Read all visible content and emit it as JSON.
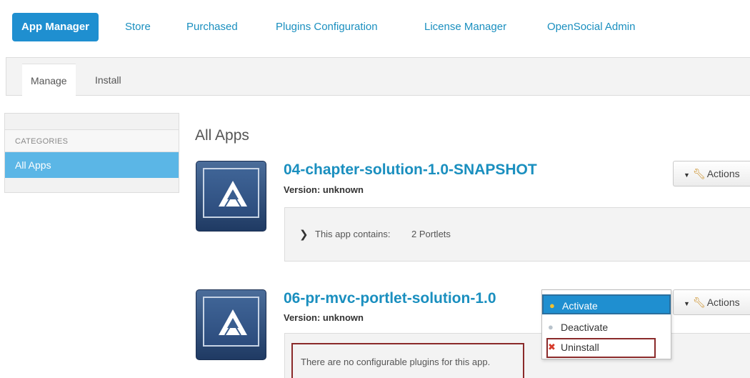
{
  "topnav": {
    "tabs": [
      {
        "label": "App Manager",
        "active": true
      },
      {
        "label": "Store"
      },
      {
        "label": "Purchased"
      },
      {
        "label": "Plugins Configuration"
      },
      {
        "label": "License Manager"
      },
      {
        "label": "OpenSocial Admin"
      }
    ]
  },
  "subnav": {
    "tabs": [
      {
        "label": "Manage",
        "active": true
      },
      {
        "label": "Install"
      }
    ]
  },
  "sidebar": {
    "heading": "CATEGORIES",
    "items": [
      {
        "label": "All Apps",
        "selected": true
      }
    ]
  },
  "main": {
    "title": "All Apps",
    "apps": [
      {
        "name": "04-chapter-solution-1.0-SNAPSHOT",
        "version": "Version: unknown",
        "contains_label": "This app contains:",
        "contains_value": "2 Portlets",
        "actions_label": "Actions"
      },
      {
        "name": "06-pr-mvc-portlet-solution-1.0",
        "version": "Version: unknown",
        "message": "There are no configurable plugins for this app.",
        "actions_label": "Actions"
      }
    ],
    "actions_menu": [
      {
        "label": "Activate",
        "icon": "lightbulb-on-icon",
        "highlighted": true
      },
      {
        "label": "Deactivate",
        "icon": "lightbulb-off-icon"
      },
      {
        "label": "Uninstall",
        "icon": "red-x-icon"
      }
    ]
  },
  "colors": {
    "accent": "#1f8fd0",
    "link": "#1a8fbf",
    "sidebar_selected": "#5bb6e6",
    "annotation": "#8a2a2a"
  }
}
